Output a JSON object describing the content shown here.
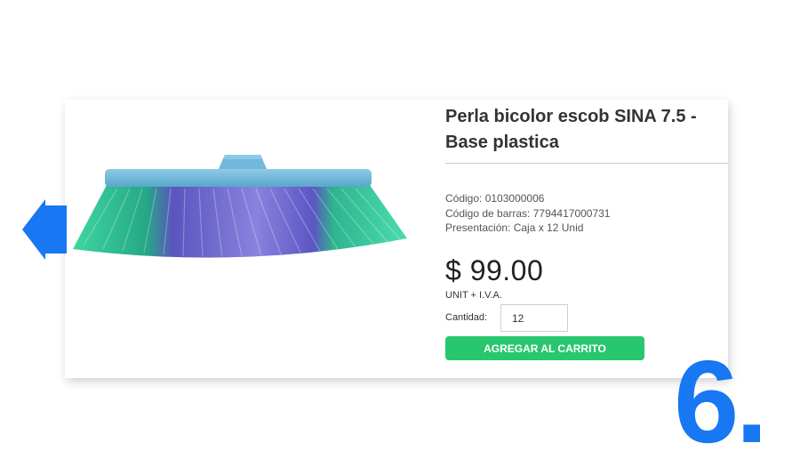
{
  "product": {
    "title": "Perla bicolor escob SINA 7.5 - Base plastica",
    "code_line": "Código: 0103000006",
    "barcode_line": "Código de barras: 7794417000731",
    "presentation_line": "Presentación: Caja x 12 Unid",
    "price": "$ 99.00",
    "price_note": "UNIT + I.V.A.",
    "image_icon": "broom-head-icon"
  },
  "quantity": {
    "label": "Cantidad:",
    "value": "12"
  },
  "actions": {
    "add_to_cart_label": "AGREGAR AL CARRITO"
  },
  "navigation": {
    "prev_icon": "arrow-left-icon"
  },
  "overlay": {
    "step_number": "6."
  },
  "colors": {
    "button_green": "#28c76f",
    "accent_blue": "#1877f2",
    "broom_green": "#27b58a",
    "broom_purple": "#6f63c9",
    "broom_base": "#6fb6d8"
  }
}
